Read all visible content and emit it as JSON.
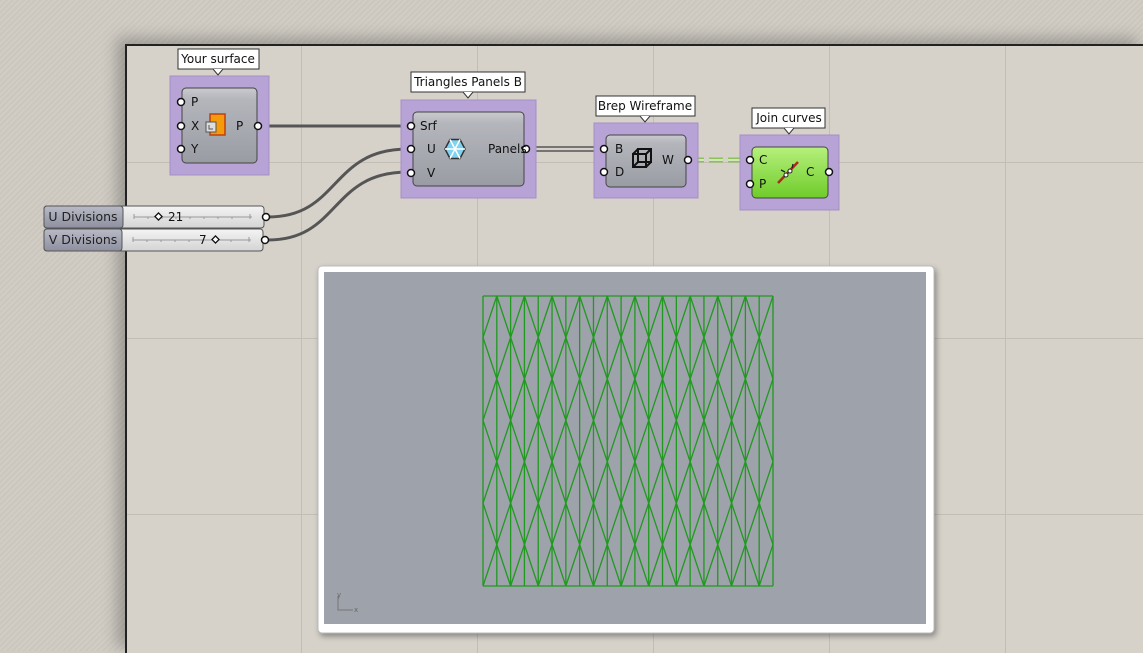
{
  "components": {
    "surface": {
      "tooltip": "Your surface",
      "inputs": [
        "P",
        "X",
        "Y"
      ],
      "outputs": [
        "P"
      ],
      "icon": "surface-icon"
    },
    "triangles": {
      "tooltip": "Triangles Panels B",
      "inputs": [
        "Srf",
        "U",
        "V"
      ],
      "outputs": [
        "Panels"
      ],
      "icon": "hexagon-triangles-icon"
    },
    "wireframe": {
      "tooltip": "Brep Wireframe",
      "inputs": [
        "B",
        "D"
      ],
      "outputs": [
        "W"
      ],
      "icon": "cube-wireframe-icon"
    },
    "join": {
      "tooltip": "Join curves",
      "inputs": [
        "C",
        "P"
      ],
      "outputs": [
        "C"
      ],
      "icon": "join-curves-icon"
    }
  },
  "sliders": [
    {
      "name": "U Divisions",
      "value": "21"
    },
    {
      "name": "V Divisions",
      "value": "7"
    }
  ],
  "viewport": {
    "u_divisions": 21,
    "v_divisions": 7,
    "axis_x": "x",
    "axis_y": "y"
  },
  "colors": {
    "group": "#b8a3d6",
    "component": "#a4a6ae",
    "join_active": "#86d93f",
    "mesh": "#1f9a1f",
    "viewport_bg": "#9ea2aa"
  }
}
